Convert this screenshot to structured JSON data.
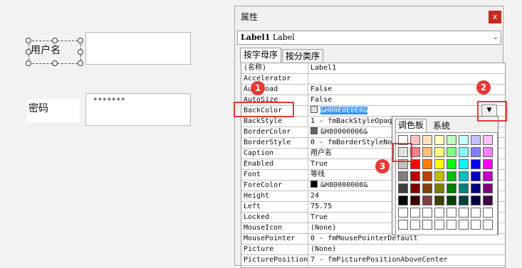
{
  "designer": {
    "label_username": "用户名",
    "label_password": "密码",
    "password_value": "*******"
  },
  "props_window": {
    "title": "属性",
    "close_label": "x",
    "object_combo_name": "Label1",
    "object_combo_type": "Label",
    "tab_alpha": "按字母序",
    "tab_category": "按分类序"
  },
  "properties": [
    {
      "name": "(名称)",
      "value": "Label1"
    },
    {
      "name": "Accelerator",
      "value": ""
    },
    {
      "name": "AutoLoad",
      "value": "False"
    },
    {
      "name": "AutoSize",
      "value": "False"
    },
    {
      "name": "BackColor",
      "value": "&H00E0E0E0&",
      "swatch": "#e0e0e0",
      "selected": true
    },
    {
      "name": "BackStyle",
      "value": "1 - fmBackStyleOpaque"
    },
    {
      "name": "BorderColor",
      "value": "&H80000006&",
      "swatch": "#646464"
    },
    {
      "name": "BorderStyle",
      "value": "0 - fmBorderStyleNone"
    },
    {
      "name": "Caption",
      "value": "用户名"
    },
    {
      "name": "Enabled",
      "value": "True"
    },
    {
      "name": "Font",
      "value": "等线"
    },
    {
      "name": "ForeColor",
      "value": "&H80000008&",
      "swatch": "#000000"
    },
    {
      "name": "Height",
      "value": "24"
    },
    {
      "name": "Left",
      "value": "75.75"
    },
    {
      "name": "Locked",
      "value": "True"
    },
    {
      "name": "MouseIcon",
      "value": "(None)"
    },
    {
      "name": "MousePointer",
      "value": "0 - fmMousePointerDefault"
    },
    {
      "name": "Picture",
      "value": "(None)"
    },
    {
      "name": "PicturePosition",
      "value": "7 - fmPicturePositionAboveCenter"
    }
  ],
  "palette": {
    "tab_palette": "调色板",
    "tab_system": "系统",
    "colors": [
      [
        "#ffffff",
        "#ffc0c0",
        "#ffe0c0",
        "#ffffc0",
        "#c0ffc0",
        "#c0ffff",
        "#c0c0ff",
        "#ffc0ff"
      ],
      [
        "#e0e0e0",
        "#ff8080",
        "#ffc080",
        "#ffff80",
        "#80ff80",
        "#80ffff",
        "#8080ff",
        "#ff80ff"
      ],
      [
        "#c0c0c0",
        "#ff0000",
        "#ff8000",
        "#ffff00",
        "#00ff00",
        "#00ffff",
        "#0000ff",
        "#ff00ff"
      ],
      [
        "#808080",
        "#c00000",
        "#c04000",
        "#c0c000",
        "#00c000",
        "#00c0c0",
        "#0000c0",
        "#c000c0"
      ],
      [
        "#404040",
        "#800000",
        "#804000",
        "#808000",
        "#008000",
        "#008080",
        "#000080",
        "#800080"
      ],
      [
        "#000000",
        "#400000",
        "#804040",
        "#404000",
        "#004000",
        "#004040",
        "#000040",
        "#400040"
      ],
      [
        "#ffffff",
        "#ffffff",
        "#ffffff",
        "#ffffff",
        "#ffffff",
        "#ffffff",
        "#ffffff",
        "#ffffff"
      ],
      [
        "#ffffff",
        "#ffffff",
        "#ffffff",
        "#ffffff",
        "#ffffff",
        "#ffffff",
        "#ffffff",
        "#ffffff"
      ]
    ]
  },
  "markers": {
    "m1": "1",
    "m2": "2",
    "m3": "3"
  },
  "colors": {
    "accent_red": "#e53935",
    "selection_blue": "#3390ff"
  }
}
